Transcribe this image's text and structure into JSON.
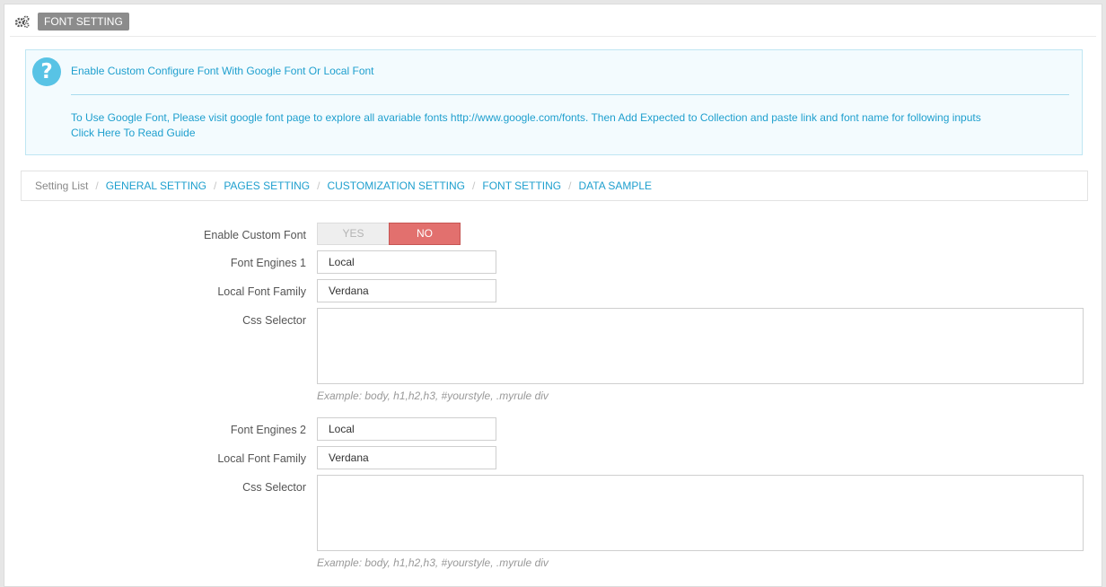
{
  "panel": {
    "heading": "FONT SETTING",
    "heading_icon": "cogs-icon"
  },
  "info": {
    "icon": "question-icon",
    "icon_glyph": "?",
    "title": "Enable Custom Configure Font With Google Font Or Local Font",
    "text": "To Use Google Font, Please visit google font page to explore all avariable fonts http://www.google.com/fonts. Then Add Expected to Collection and paste link and font name for following inputs",
    "link": "Click Here To Read Guide"
  },
  "breadcrumb": {
    "root": "Setting List",
    "separator": "/",
    "items": [
      "GENERAL SETTING",
      "PAGES SETTING",
      "CUSTOMIZATION SETTING",
      "FONT SETTING",
      "DATA SAMPLE"
    ]
  },
  "form": {
    "enable_label": "Enable Custom Font",
    "toggle": {
      "yes": "YES",
      "no": "NO",
      "selected": "NO"
    },
    "group1": {
      "engine_label": "Font Engines 1",
      "engine_value": "Local",
      "family_label": "Local Font Family",
      "family_value": "Verdana",
      "selector_label": "Css Selector",
      "selector_value": "",
      "help": "Example: body, h1,h2,h3, #yourstyle, .myrule div"
    },
    "group2": {
      "engine_label": "Font Engines 2",
      "engine_value": "Local",
      "family_label": "Local Font Family",
      "family_value": "Verdana",
      "selector_label": "Css Selector",
      "selector_value": "",
      "help": "Example: body, h1,h2,h3, #yourstyle, .myrule div"
    }
  },
  "colors": {
    "accent": "#1e9fce",
    "toggle_no": "#e2706e",
    "info_bg": "#f3fbfe"
  }
}
